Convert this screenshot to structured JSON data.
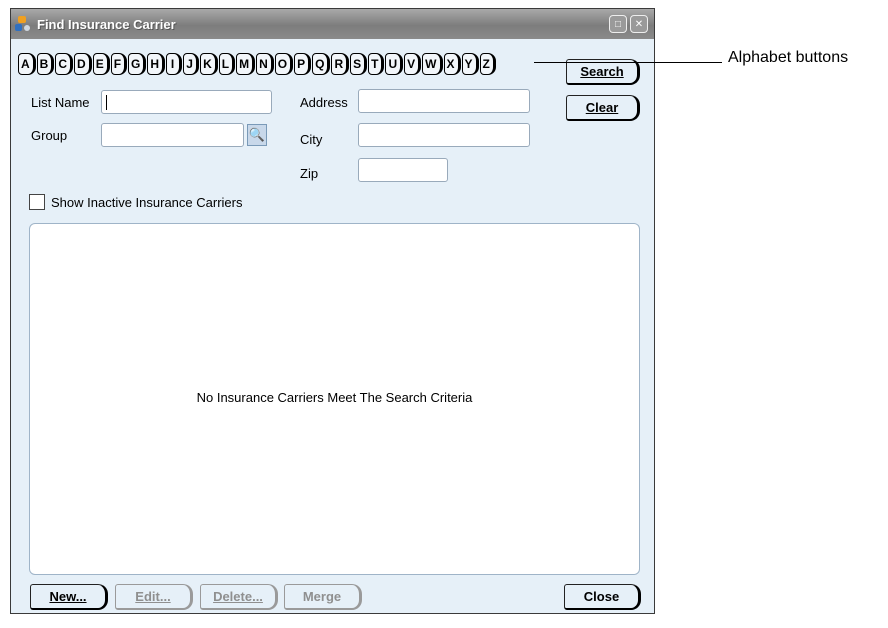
{
  "window": {
    "title": "Find Insurance Carrier",
    "controls": [
      "restore-icon",
      "close-icon"
    ]
  },
  "alphabet": [
    "A",
    "B",
    "C",
    "D",
    "E",
    "F",
    "G",
    "H",
    "I",
    "J",
    "K",
    "L",
    "M",
    "N",
    "O",
    "P",
    "Q",
    "R",
    "S",
    "T",
    "U",
    "V",
    "W",
    "X",
    "Y",
    "Z"
  ],
  "search_form": {
    "list_name_label": "List Name",
    "list_name_value": "",
    "group_label": "Group",
    "group_value": "",
    "address_label": "Address",
    "address_value": "",
    "city_label": "City",
    "city_value": "",
    "zip_label": "Zip",
    "zip_value": "",
    "show_inactive_label": "Show Inactive Insurance Carriers",
    "show_inactive_checked": false
  },
  "buttons": {
    "search": "Search",
    "clear": "Clear",
    "new": "New...",
    "edit": "Edit...",
    "delete": "Delete...",
    "merge": "Merge",
    "close": "Close"
  },
  "results": {
    "empty_message": "No Insurance Carriers Meet The Search Criteria"
  },
  "callout": {
    "text": "Alphabet buttons"
  }
}
